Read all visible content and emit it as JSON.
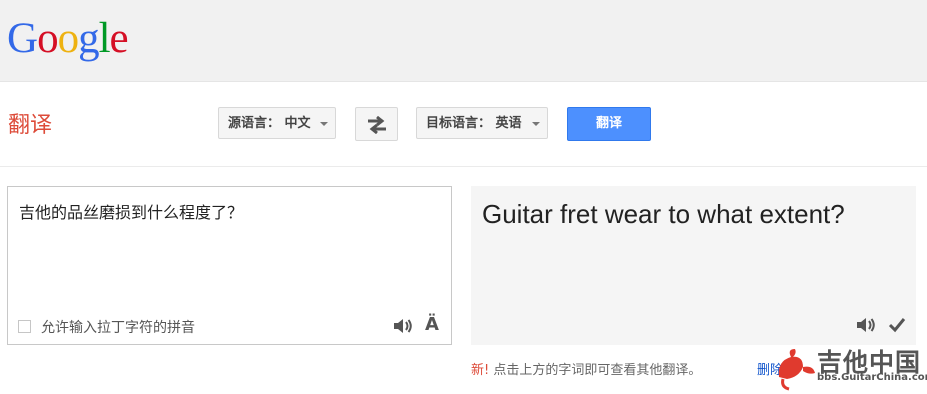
{
  "header": {
    "logo_letters": [
      "G",
      "o",
      "o",
      "g",
      "l",
      "e"
    ],
    "logo_colors": [
      "#3369e8",
      "#d50f25",
      "#eeb211",
      "#3369e8",
      "#009925",
      "#d50f25"
    ]
  },
  "toolbar": {
    "title": "翻译",
    "source_language_label": "源语言： 中文",
    "target_language_label": "目标语言： 英语",
    "translate_button": "翻译",
    "swap_icon": "swap-arrows-icon"
  },
  "source": {
    "text": "吉他的品丝磨损到什么程度了？",
    "checkbox_label": "允许输入拉丁字符的拼音",
    "checkbox_checked": false,
    "speaker_icon": "speaker-icon",
    "input_tools_icon": "Ä"
  },
  "result": {
    "text": "Guitar fret wear to what extent?",
    "speaker_icon": "speaker-icon",
    "check_icon": "check-icon"
  },
  "footer": {
    "new_label": "新!",
    "hint": " 点击上方的字词即可查看其他翻译。",
    "delete_link": "删除"
  },
  "watermark": {
    "title": "吉他中国",
    "subtitle": "bbs.GuitarChina.com"
  },
  "colors": {
    "accent_red": "#dd4b39",
    "button_blue": "#4d90fe",
    "link_blue": "#1155cc"
  }
}
